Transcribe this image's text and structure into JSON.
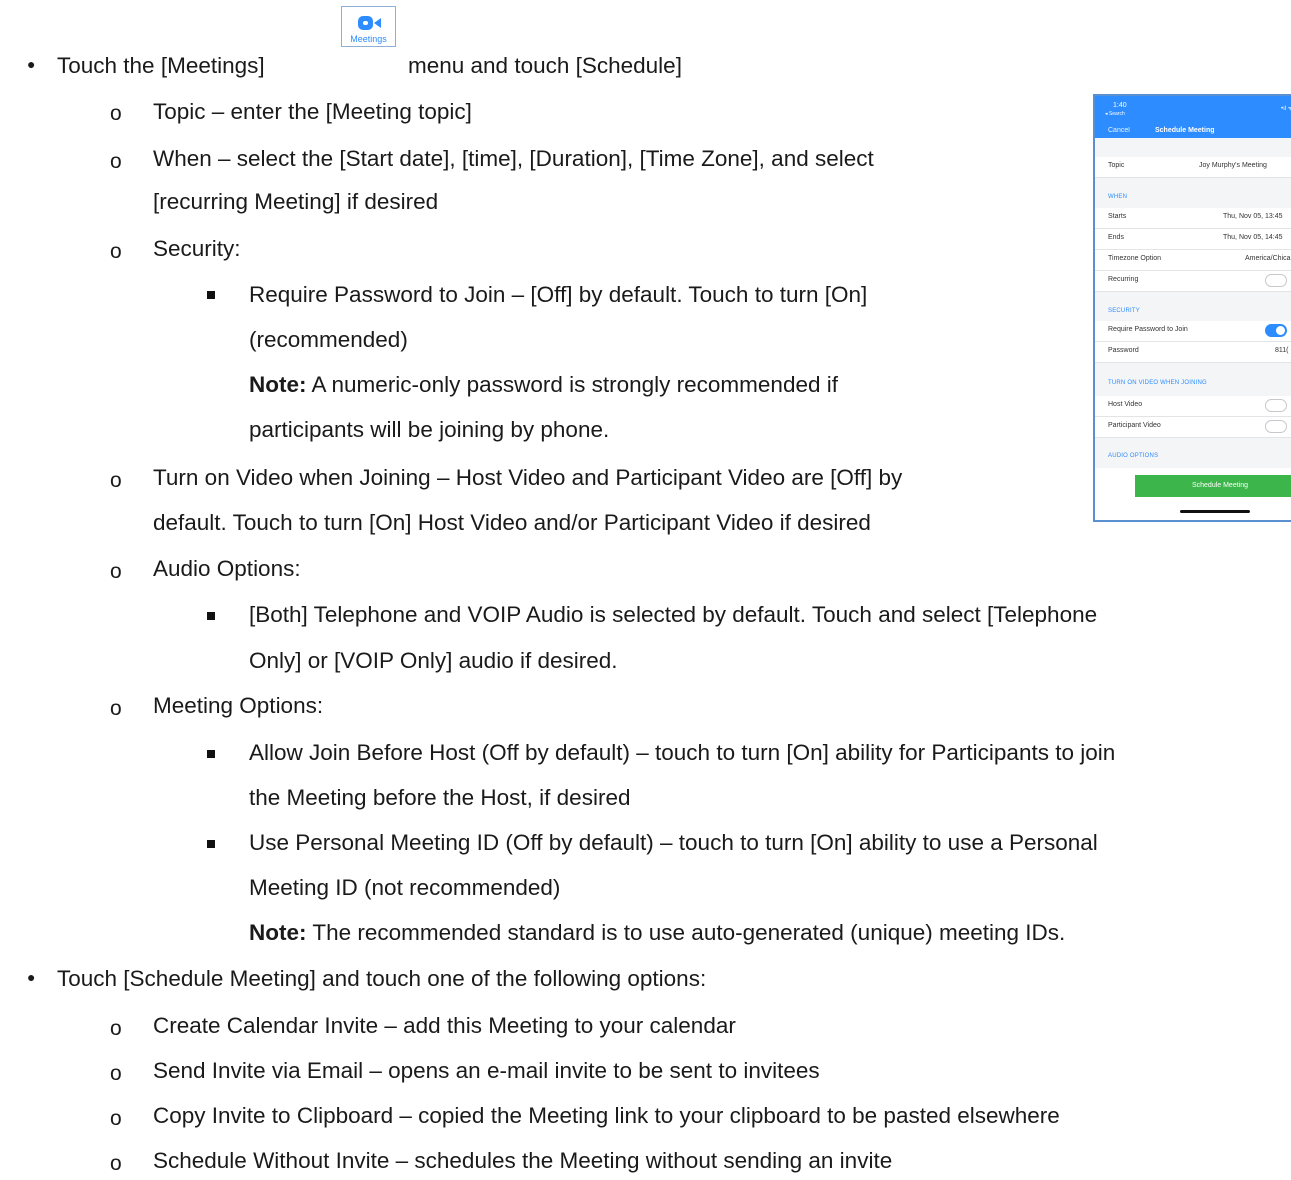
{
  "meetings_icon_label": "Meetings",
  "lines": {
    "l1a": "Touch the [Meetings]",
    "l1b": "menu and touch [Schedule]",
    "l2": "Topic – enter the [Meeting topic]",
    "l3": "When – select the [Start date], [time], [Duration], [Time Zone], and select",
    "l4": "[recurring Meeting] if desired",
    "l5": "Security:",
    "l6": "Require Password to Join – [Off] by default. Touch to turn [On]",
    "l7": "(recommended)",
    "note_label": "Note:",
    "l8": "A numeric-only password is strongly recommended if",
    "l9": "participants will be joining by phone.",
    "l10": "Turn on Video when Joining – Host Video and Participant Video are [Off] by",
    "l11": "default. Touch to turn [On] Host Video and/or Participant Video if desired",
    "l12": "Audio Options:",
    "l13": "[Both] Telephone and VOIP Audio is selected by default. Touch and select [Telephone",
    "l14": "Only] or [VOIP Only] audio if desired.",
    "l15": "Meeting Options:",
    "l16": "Allow Join Before Host (Off by default) – touch to turn [On] ability for Participants to join",
    "l17": "the Meeting before the Host, if desired",
    "l18": "Use Personal Meeting ID (Off by default) – touch to turn [On] ability to use a Personal",
    "l19": "Meeting ID (not recommended)",
    "l20": "The recommended standard is to use auto-generated (unique) meeting IDs.",
    "l21": "Touch [Schedule Meeting] and touch one of the following options:",
    "l22": "Create Calendar Invite – add this Meeting to your calendar",
    "l23": "Send Invite via Email – opens an e-mail invite to be sent to invitees",
    "l24": "Copy Invite to Clipboard – copied the Meeting link to your clipboard to be pasted elsewhere",
    "l25": "Schedule Without Invite – schedules the Meeting without sending an invite"
  },
  "phone": {
    "time": "1:40",
    "back": "◂ Search",
    "signal": "•ıl ᯤ",
    "cancel": "Cancel",
    "title": "Schedule Meeting",
    "topic_label": "Topic",
    "topic_value": "Joy Murphy's Meeting",
    "when_header": "WHEN",
    "starts_label": "Starts",
    "starts_value": "Thu, Nov 05, 13:45",
    "ends_label": "Ends",
    "ends_value": "Thu, Nov 05, 14:45",
    "tz_label": "Timezone Option",
    "tz_value": "America/Chica",
    "recurring_label": "Recurring",
    "security_header": "SECURITY",
    "password_req_label": "Require Password to Join",
    "password_label": "Password",
    "password_value": "811(",
    "video_header": "TURN ON VIDEO WHEN JOINING",
    "host_video_label": "Host Video",
    "participant_video_label": "Participant Video",
    "audio_header": "AUDIO OPTIONS",
    "schedule_button": "Schedule Meeting",
    "require_password_on": true,
    "recurring_on": false,
    "host_video_on": false,
    "participant_video_on": false
  }
}
